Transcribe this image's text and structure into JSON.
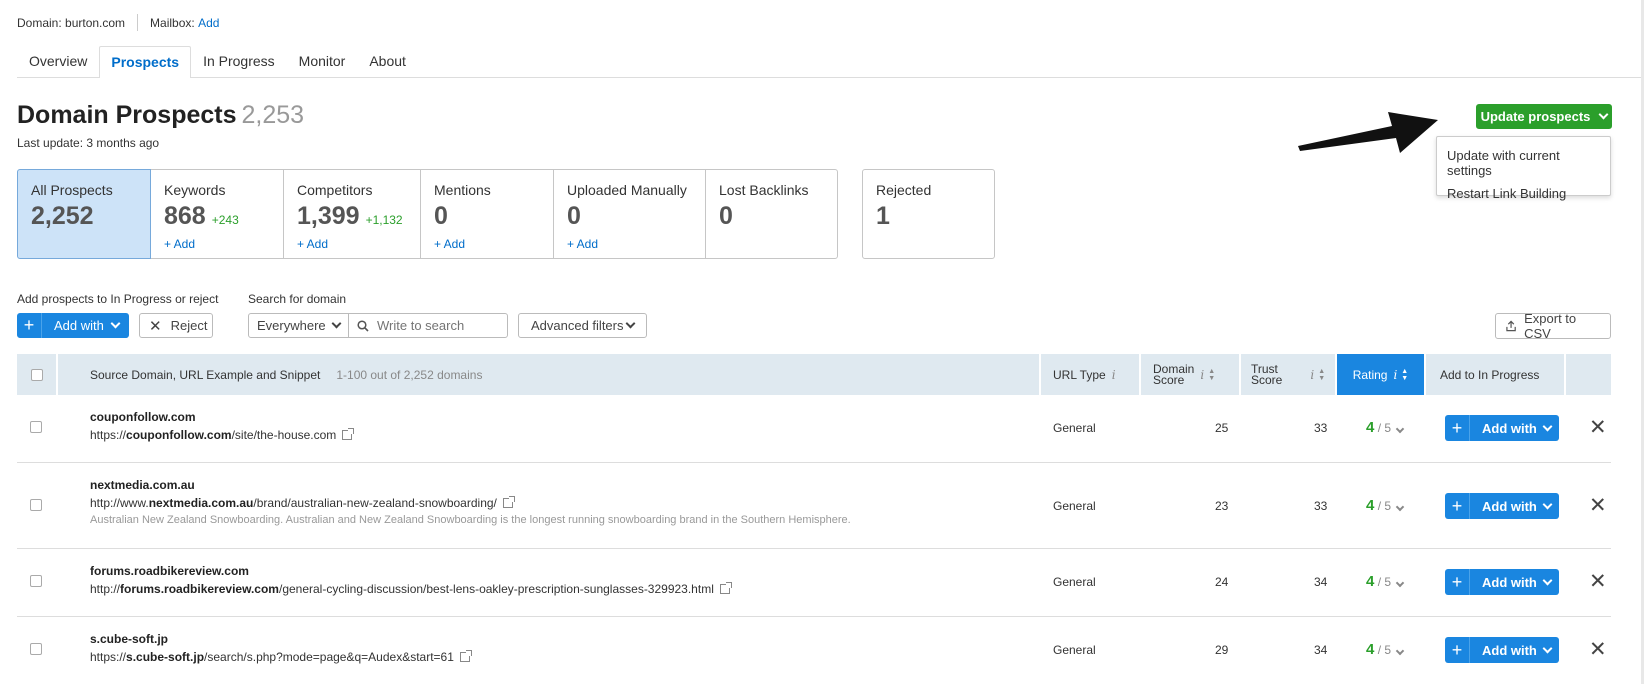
{
  "topbar": {
    "domain": "Domain: burton.com",
    "mailbox_label": "Mailbox:",
    "mailbox_add": "Add"
  },
  "tabs": [
    {
      "label": "Overview",
      "active": false
    },
    {
      "label": "Prospects",
      "active": true
    },
    {
      "label": "In Progress",
      "active": false
    },
    {
      "label": "Monitor",
      "active": false
    },
    {
      "label": "About",
      "active": false
    }
  ],
  "page": {
    "title": "Domain Prospects",
    "count": "2,253",
    "last_update": "Last update: 3 months ago"
  },
  "cards": [
    {
      "label": "All Prospects",
      "value": "2,252",
      "delta": "",
      "add": ""
    },
    {
      "label": "Keywords",
      "value": "868",
      "delta": "+243",
      "add": "+ Add"
    },
    {
      "label": "Competitors",
      "value": "1,399",
      "delta": "+1,132",
      "add": "+ Add"
    },
    {
      "label": "Mentions",
      "value": "0",
      "delta": "",
      "add": "+ Add"
    },
    {
      "label": "Uploaded Manually",
      "value": "0",
      "delta": "",
      "add": "+ Add"
    },
    {
      "label": "Lost Backlinks",
      "value": "0",
      "delta": "",
      "add": ""
    },
    {
      "label": "Rejected",
      "value": "1",
      "delta": "",
      "add": ""
    }
  ],
  "toolbar": {
    "add_label": "Add prospects to In Progress or reject",
    "add_with": "Add with",
    "reject": "Reject",
    "search_label": "Search for domain",
    "scope": "Everywhere",
    "search_placeholder": "Write to search",
    "advanced": "Advanced filters",
    "export": "Export to CSV"
  },
  "table": {
    "columns": {
      "source": "Source Domain, URL Example and Snippet",
      "range": "1-100 out of 2,252 domains",
      "url_type": "URL Type",
      "domain_score_1": "Domain",
      "domain_score_2": "Score",
      "trust_score_1": "Trust",
      "trust_score_2": "Score",
      "rating": "Rating",
      "add": "Add to In Progress"
    },
    "rows": [
      {
        "domain": "couponfollow.com",
        "url_pre": "https://",
        "url_bold": "couponfollow.com",
        "url_post": "/site/the-house.com",
        "snippet": "",
        "url_type": "General",
        "domain_score": "25",
        "trust_score": "33",
        "rating": "4",
        "rating_max": "/ 5",
        "add": "Add with"
      },
      {
        "domain": "nextmedia.com.au",
        "url_pre": "http://www.",
        "url_bold": "nextmedia.com.au",
        "url_post": "/brand/australian-new-zealand-snowboarding/",
        "snippet": "Australian New Zealand Snowboarding. Australian and New Zealand Snowboarding is the longest running snowboarding brand in the Southern Hemisphere.",
        "url_type": "General",
        "domain_score": "23",
        "trust_score": "33",
        "rating": "4",
        "rating_max": "/ 5",
        "add": "Add with"
      },
      {
        "domain": "forums.roadbikereview.com",
        "url_pre": "http://",
        "url_bold": "forums.roadbikereview.com",
        "url_post": "/general-cycling-discussion/best-lens-oakley-prescription-sunglasses-329923.html",
        "snippet": "",
        "url_type": "General",
        "domain_score": "24",
        "trust_score": "34",
        "rating": "4",
        "rating_max": "/ 5",
        "add": "Add with"
      },
      {
        "domain": "s.cube-soft.jp",
        "url_pre": "https://",
        "url_bold": "s.cube-soft.jp",
        "url_post": "/search/s.php?mode=page&q=Audex&start=61",
        "snippet": "",
        "url_type": "General",
        "domain_score": "29",
        "trust_score": "34",
        "rating": "4",
        "rating_max": "/ 5",
        "add": "Add with"
      }
    ]
  },
  "update": {
    "button": "Update prospects",
    "menu": [
      "Update with current settings",
      "Restart Link Building"
    ]
  },
  "colors": {
    "accent_blue": "#1a86e0",
    "green": "#2b9f2b",
    "link": "#006dca",
    "header_bg": "#dfe9f0"
  }
}
